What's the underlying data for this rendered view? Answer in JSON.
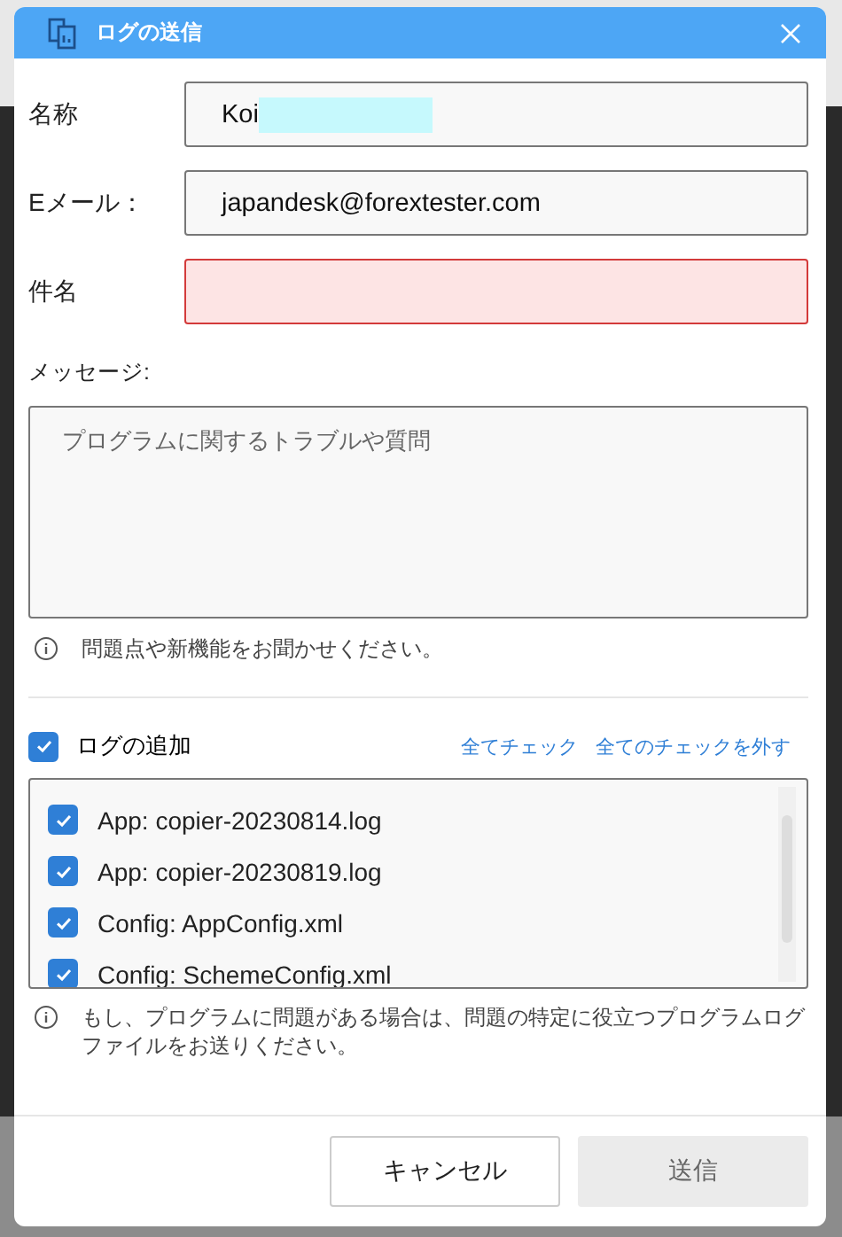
{
  "window": {
    "title": "ログの送信"
  },
  "fields": [
    {
      "label": "名称",
      "value": "Koi",
      "redacted": true,
      "invalid": false
    },
    {
      "label": "Eメール：",
      "value": "japandesk@forextester.com",
      "invalid": false
    },
    {
      "label": "件名",
      "invalid": true
    }
  ],
  "message": {
    "label": "メッセージ:",
    "placeholder": "プログラムに関するトラブルや質問"
  },
  "message_hint": "問題点や新機能をお聞かせください。",
  "logs": {
    "label": "ログの追加",
    "checked": true,
    "check_all": "全てチェック",
    "uncheck_all": "全てのチェックを外す",
    "items": [
      {
        "label": "App: copier-20230814.log",
        "checked": true
      },
      {
        "label": "App: copier-20230819.log",
        "checked": true
      },
      {
        "label": "Config: AppConfig.xml",
        "checked": true
      },
      {
        "label": "Config: SchemeConfig.xml",
        "checked": true
      }
    ]
  },
  "logs_note": "もし、プログラムに問題がある場合は、問題の特定に役立つプログラムログファイルをお送りください。",
  "buttons": [
    {
      "label": "キャンセル",
      "disabled": false
    },
    {
      "label": "送信",
      "disabled": true
    }
  ]
}
